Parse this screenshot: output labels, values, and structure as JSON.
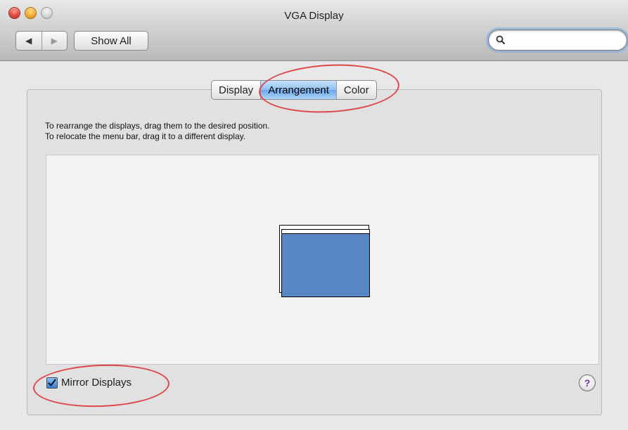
{
  "window": {
    "title": "VGA Display"
  },
  "toolbar": {
    "back_glyph": "◀",
    "forward_glyph": "▶",
    "show_all_label": "Show All",
    "search_value": "",
    "search_placeholder": ""
  },
  "tabs": [
    {
      "label": "Display",
      "selected": false
    },
    {
      "label": "Arrangement",
      "selected": true
    },
    {
      "label": "Color",
      "selected": false
    }
  ],
  "instructions": {
    "line1": "To rearrange the displays, drag them to the desired position.",
    "line2": "To relocate the menu bar, drag it to a different display."
  },
  "mirror": {
    "label": "Mirror Displays",
    "checked": true
  },
  "help": {
    "glyph": "?"
  },
  "colors": {
    "display_blue": "#5887c6",
    "selected_tab": "#8dc0f2",
    "annotation_red": "#e0454a"
  },
  "icons": [
    "close-icon",
    "minimize-icon",
    "zoom-icon",
    "back-arrow-icon",
    "forward-arrow-icon",
    "search-icon",
    "checkmark-icon",
    "help-icon"
  ]
}
